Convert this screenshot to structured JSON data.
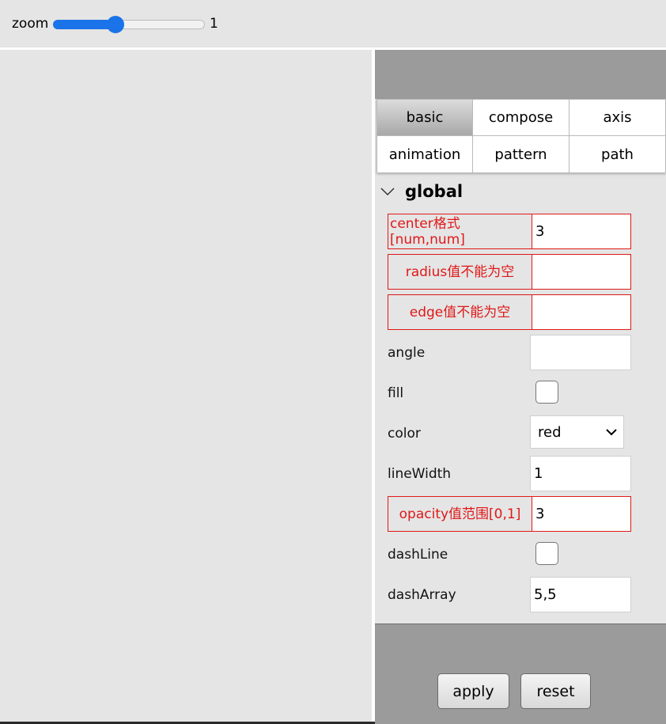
{
  "toolbar": {
    "zoom_label": "zoom",
    "zoom_value": "1",
    "zoom_fraction": 0.4
  },
  "tabs": [
    {
      "label": "basic",
      "active": true
    },
    {
      "label": "compose",
      "active": false
    },
    {
      "label": "axis",
      "active": false
    },
    {
      "label": "animation",
      "active": false
    },
    {
      "label": "pattern",
      "active": false
    },
    {
      "label": "path",
      "active": false
    }
  ],
  "section": {
    "title": "global"
  },
  "fields": {
    "center": {
      "label": "center格式[num,num]",
      "value": "3"
    },
    "radius": {
      "label": "radius值不能为空",
      "value": ""
    },
    "edge": {
      "label": "edge值不能为空",
      "value": ""
    },
    "angle": {
      "label": "angle",
      "value": ""
    },
    "fill": {
      "label": "fill",
      "checked": false
    },
    "color": {
      "label": "color",
      "value": "red"
    },
    "lineWidth": {
      "label": "lineWidth",
      "value": "1"
    },
    "opacity": {
      "label": "opacity值范围[0,1]",
      "value": "3"
    },
    "dashLine": {
      "label": "dashLine",
      "checked": false
    },
    "dashArray": {
      "label": "dashArray",
      "value": "5,5"
    }
  },
  "actions": {
    "apply": "apply",
    "reset": "reset"
  },
  "colors": {
    "error": "#e01818",
    "accent": "#1a73e8",
    "panel_chrome": "#9b9b9b"
  }
}
